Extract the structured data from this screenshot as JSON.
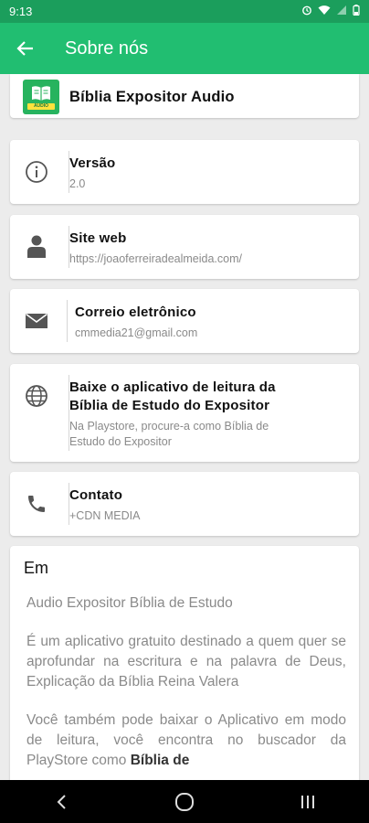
{
  "status": {
    "time": "9:13"
  },
  "app_bar": {
    "title": "Sobre nós"
  },
  "app_card": {
    "name": "Bíblia Expositor Audio",
    "logo_text": "AUDIO"
  },
  "version": {
    "title": "Versão",
    "value": "2.0"
  },
  "website": {
    "title": "Site web",
    "value": "https://joaoferreiradealmeida.com/"
  },
  "email": {
    "title": "Correio eletrônico",
    "value": "cmmedia21@gmail.com"
  },
  "download": {
    "title_line1": "Baixe o aplicativo de leitura da",
    "title_line2": "Bíblia de Estudo do Expositor",
    "sub_line1": "Na Playstore, procure-a como Bíblia de",
    "sub_line2": "Estudo do Expositor"
  },
  "contact": {
    "title": "Contato",
    "value": "+CDN MEDIA"
  },
  "em": {
    "title": "Em",
    "p1": "Audio Expositor Bíblia de Estudo",
    "p2": "É um aplicativo gratuito destinado a quem quer se aprofundar na escritura e na palavra de Deus, Explicação da Bíblia Reina Valera",
    "p3_start": "Você também pode baixar o Aplicativo em modo de leitura, você encontra no buscador da PlayStore como ",
    "p3_bold": "Bíblia de"
  },
  "colors": {
    "primary": "#21be71",
    "status_bar": "#1b9e5c"
  },
  "icons": [
    "back-arrow-icon",
    "info-icon",
    "person-icon",
    "mail-icon",
    "globe-icon",
    "phone-icon"
  ]
}
